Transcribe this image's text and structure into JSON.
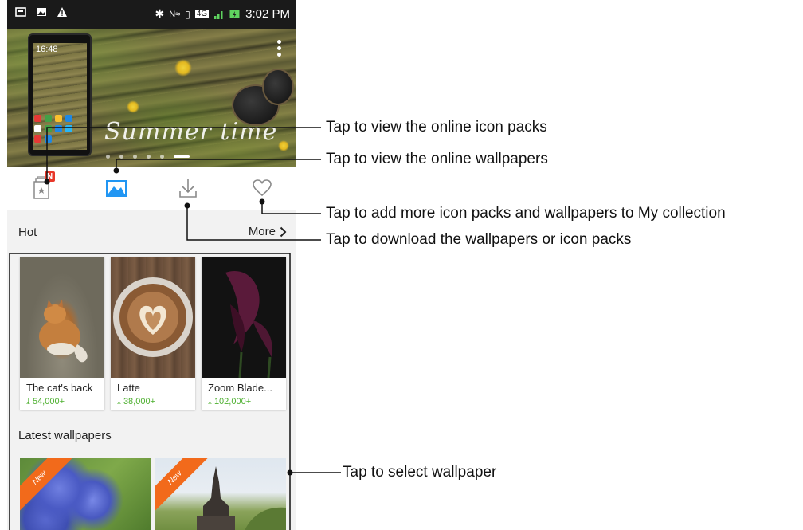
{
  "status_bar": {
    "time": "3:02 PM",
    "icons": [
      "notification-icon",
      "image-icon",
      "warning-icon",
      "bluetooth-icon",
      "nfc-icon",
      "vibrate-icon",
      "4g-icon",
      "signal-icon",
      "battery-charging-icon"
    ]
  },
  "hero": {
    "title": "Summer time",
    "mini_phone_clock": "16:48"
  },
  "toolbar": {
    "badge": "N",
    "icons": [
      "icon-packs-icon",
      "wallpapers-icon",
      "download-icon",
      "heart-icon"
    ],
    "accent": "#2196f3"
  },
  "hot": {
    "title": "Hot",
    "more": "More",
    "items": [
      {
        "name": "The cat's back",
        "downloads": "54,000+"
      },
      {
        "name": "Latte",
        "downloads": "38,000+"
      },
      {
        "name": "Zoom Blade...",
        "downloads": "102,000+"
      }
    ]
  },
  "latest": {
    "title": "Latest wallpapers",
    "items": [
      {
        "ribbon": "New"
      },
      {
        "ribbon": "New"
      }
    ]
  },
  "annotations": {
    "icon_packs": "Tap to view the online icon packs",
    "wallpapers": "Tap to view the online wallpapers",
    "collection": "Tap to add more icon packs and wallpapers to My collection",
    "download": "Tap to download the wallpapers or icon packs",
    "select": "Tap to select wallpaper"
  },
  "colors": {
    "badge": "#e8382a",
    "download_count": "#4caf2e",
    "ribbon": "#f26a1b"
  }
}
